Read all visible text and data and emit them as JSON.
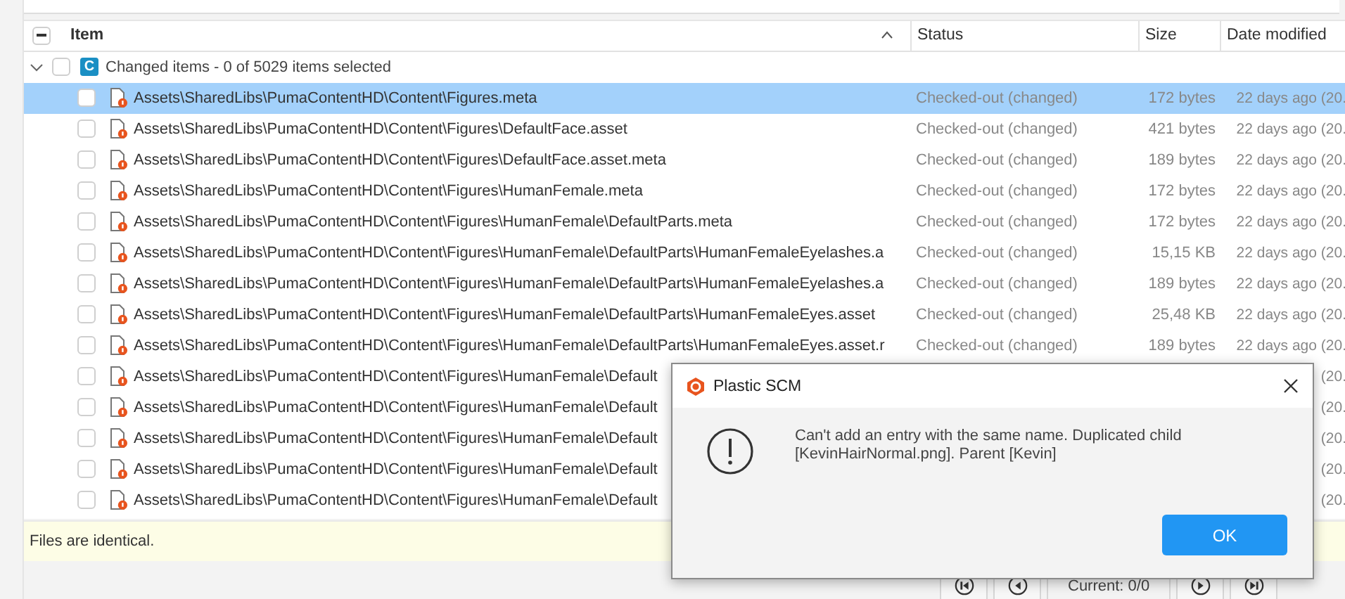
{
  "table": {
    "header_checkbox": {
      "indeterminate": true
    },
    "columns": [
      {
        "label": "Item",
        "sorted": true
      },
      {
        "label": "Status"
      },
      {
        "label": "Size"
      },
      {
        "label": "Date modified"
      }
    ],
    "group": {
      "label": "Changed items - 0 of 5029 items selected",
      "badge": "C",
      "expanded": true,
      "checked": false
    },
    "rows": [
      {
        "item": "Assets\\SharedLibs\\PumaContentHD\\Content\\Figures.meta",
        "status": "Checked-out (changed)",
        "size": "172 bytes",
        "date": "22 days ago (20.",
        "selected": true,
        "checked": false
      },
      {
        "item": "Assets\\SharedLibs\\PumaContentHD\\Content\\Figures\\DefaultFace.asset",
        "status": "Checked-out (changed)",
        "size": "421 bytes",
        "date": "22 days ago (20.",
        "selected": false,
        "checked": false
      },
      {
        "item": "Assets\\SharedLibs\\PumaContentHD\\Content\\Figures\\DefaultFace.asset.meta",
        "status": "Checked-out (changed)",
        "size": "189 bytes",
        "date": "22 days ago (20.",
        "selected": false,
        "checked": false
      },
      {
        "item": "Assets\\SharedLibs\\PumaContentHD\\Content\\Figures\\HumanFemale.meta",
        "status": "Checked-out (changed)",
        "size": "172 bytes",
        "date": "22 days ago (20.",
        "selected": false,
        "checked": false
      },
      {
        "item": "Assets\\SharedLibs\\PumaContentHD\\Content\\Figures\\HumanFemale\\DefaultParts.meta",
        "status": "Checked-out (changed)",
        "size": "172 bytes",
        "date": "22 days ago (20.",
        "selected": false,
        "checked": false
      },
      {
        "item": "Assets\\SharedLibs\\PumaContentHD\\Content\\Figures\\HumanFemale\\DefaultParts\\HumanFemaleEyelashes.a",
        "status": "Checked-out (changed)",
        "size": "15,15 KB",
        "date": "22 days ago (20.",
        "selected": false,
        "checked": false
      },
      {
        "item": "Assets\\SharedLibs\\PumaContentHD\\Content\\Figures\\HumanFemale\\DefaultParts\\HumanFemaleEyelashes.a",
        "status": "Checked-out (changed)",
        "size": "189 bytes",
        "date": "22 days ago (20.",
        "selected": false,
        "checked": false
      },
      {
        "item": "Assets\\SharedLibs\\PumaContentHD\\Content\\Figures\\HumanFemale\\DefaultParts\\HumanFemaleEyes.asset",
        "status": "Checked-out (changed)",
        "size": "25,48 KB",
        "date": "22 days ago (20.",
        "selected": false,
        "checked": false
      },
      {
        "item": "Assets\\SharedLibs\\PumaContentHD\\Content\\Figures\\HumanFemale\\DefaultParts\\HumanFemaleEyes.asset.r",
        "status": "Checked-out (changed)",
        "size": "189 bytes",
        "date": "22 days ago (20.",
        "selected": false,
        "checked": false
      },
      {
        "item": "Assets\\SharedLibs\\PumaContentHD\\Content\\Figures\\HumanFemale\\Default",
        "date": "(20.",
        "selected": false,
        "checked": false
      },
      {
        "item": "Assets\\SharedLibs\\PumaContentHD\\Content\\Figures\\HumanFemale\\Default",
        "date": "(20.",
        "selected": false,
        "checked": false
      },
      {
        "item": "Assets\\SharedLibs\\PumaContentHD\\Content\\Figures\\HumanFemale\\Default",
        "date": "(20.",
        "selected": false,
        "checked": false
      },
      {
        "item": "Assets\\SharedLibs\\PumaContentHD\\Content\\Figures\\HumanFemale\\Default",
        "date": "(20.",
        "selected": false,
        "checked": false
      },
      {
        "item": "Assets\\SharedLibs\\PumaContentHD\\Content\\Figures\\HumanFemale\\Default",
        "date": "(20.",
        "selected": false,
        "checked": false
      }
    ]
  },
  "info_bar": {
    "text": "Files are identical."
  },
  "navigator": {
    "buttons": [
      {
        "kind": "first"
      },
      {
        "kind": "prev"
      }
    ],
    "current": "Current: 0/0",
    "buttons_after": [
      {
        "kind": "next"
      },
      {
        "kind": "last"
      }
    ]
  },
  "dialog": {
    "title": "Plastic SCM",
    "message": "Can't add an entry with the same name. Duplicated child [KevinHairNormal.png]. Parent [Kevin]",
    "button": "OK"
  }
}
